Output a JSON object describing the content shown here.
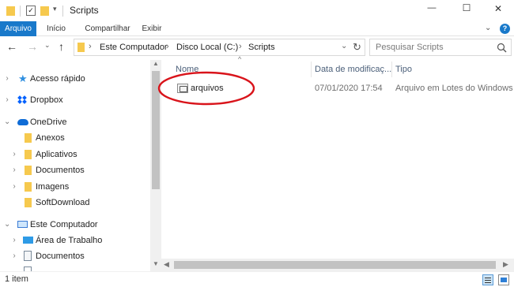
{
  "window": {
    "title": "Scripts",
    "controls": {
      "minimize": "—",
      "maximize": "☐",
      "close": "✕"
    }
  },
  "ribbon": {
    "tabs": [
      {
        "label": "Arquivo",
        "active": true
      },
      {
        "label": "Início"
      },
      {
        "label": "Compartilhar"
      },
      {
        "label": "Exibir"
      }
    ],
    "help": "?"
  },
  "address": {
    "segments": [
      "Este Computador",
      "Disco Local (C:)",
      "Scripts"
    ],
    "search_placeholder": "Pesquisar Scripts"
  },
  "nav": {
    "items": [
      {
        "label": "Acesso rápido",
        "icon": "star-icon",
        "level": 0,
        "chevron": "right"
      },
      {
        "label": "Dropbox",
        "icon": "dropbox-icon",
        "level": 0,
        "chevron": "right"
      },
      {
        "label": "OneDrive",
        "icon": "cloud-icon",
        "level": 0,
        "chevron": "down"
      },
      {
        "label": "Anexos",
        "icon": "folder-icon",
        "level": 1,
        "chevron": ""
      },
      {
        "label": "Aplicativos",
        "icon": "folder-icon",
        "level": 1,
        "chevron": "right"
      },
      {
        "label": "Documentos",
        "icon": "folder-icon",
        "level": 1,
        "chevron": "right"
      },
      {
        "label": "Imagens",
        "icon": "folder-icon",
        "level": 1,
        "chevron": "right"
      },
      {
        "label": "SoftDownload",
        "icon": "folder-icon",
        "level": 1,
        "chevron": ""
      },
      {
        "label": "Este Computador",
        "icon": "computer-icon",
        "level": 0,
        "chevron": "down"
      },
      {
        "label": "Área de Trabalho",
        "icon": "desktop-icon",
        "level": 1,
        "chevron": "right"
      },
      {
        "label": "Documentos",
        "icon": "document-icon",
        "level": 1,
        "chevron": "right"
      }
    ]
  },
  "filelist": {
    "columns": [
      "Nome",
      "Data de modificaç...",
      "Tipo"
    ],
    "rows": [
      {
        "name": "arquivos",
        "date": "07/01/2020 17:54",
        "type": "Arquivo em Lotes do Windows"
      }
    ]
  },
  "status": {
    "count": "1 item"
  },
  "colors": {
    "accent": "#1979ca",
    "annotation": "#d9141b",
    "folder": "#f6c94e"
  }
}
